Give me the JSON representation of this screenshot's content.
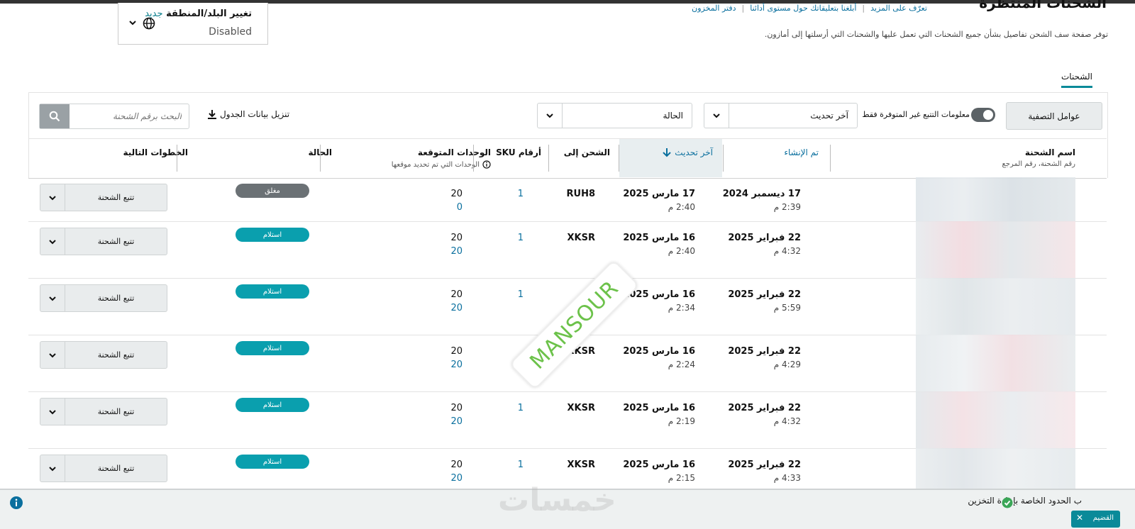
{
  "header": {
    "country_label": "تغيير البلد/المنطقة",
    "country_new": "جديد",
    "country_value": "Disabled",
    "page_title": "الشحنات المنتظرة",
    "links": [
      "تعرّف على المزيد",
      "أبلغنا بتعليقاتك حول مستوى أدائنا",
      "دفتر المخزون"
    ],
    "description": "توفر صفحة سف الشحن تفاصيل بشأن جميع الشحنات التي تعمل عليها والشحنات التي أرسلتها إلى أمازون."
  },
  "tabs": {
    "shipments": "الشحنات"
  },
  "toolbar": {
    "filters_label": "عوامل التصفية",
    "toggle_label": "معلومات التتبع غير المتوفرة فقط",
    "sort_select": "آخر تحديث",
    "status_select": "الحالة",
    "download_label": "تنزيل بيانات الجدول",
    "search_placeholder": "البحث برقم الشحنة"
  },
  "table": {
    "headers": {
      "name": "اسم الشحنة",
      "name_sub": "رقم الشحنة، رقم المرجع",
      "created": "تم الإنشاء",
      "updated": "آخر تحديث",
      "ship_to": "الشحن إلى",
      "sku": "أرقام SKU",
      "units": "الوحدات المتوقعة",
      "units_sub": "الوحدات التي تم تحديد موقعها",
      "status": "الحالة",
      "next_steps": "الخطوات التالية"
    },
    "track_label": "تتبع الشحنة",
    "rows": [
      {
        "created_date": "17 ديسمبر 2024",
        "created_time": "2:39 م",
        "updated_date": "17 مارس 2025",
        "updated_time": "2:40 م",
        "ship_to": "RUH8",
        "sku": "1",
        "units": "20",
        "located": "0",
        "status": "مغلق",
        "status_color": "#6b7175"
      },
      {
        "created_date": "22 فبراير 2025",
        "created_time": "4:32 م",
        "updated_date": "16 مارس 2025",
        "updated_time": "2:40 م",
        "ship_to": "XKSR",
        "sku": "1",
        "units": "20",
        "located": "20",
        "status": "استلام",
        "status_color": "#0a9fae"
      },
      {
        "created_date": "22 فبراير 2025",
        "created_time": "5:59 م",
        "updated_date": "16 مارس 2025",
        "updated_time": "2:34 م",
        "ship_to": "",
        "sku": "1",
        "units": "20",
        "located": "20",
        "status": "استلام",
        "status_color": "#0a9fae"
      },
      {
        "created_date": "22 فبراير 2025",
        "created_time": "4:29 م",
        "updated_date": "16 مارس 2025",
        "updated_time": "2:24 م",
        "ship_to": "XKSR",
        "sku": "",
        "units": "20",
        "located": "20",
        "status": "استلام",
        "status_color": "#0a9fae"
      },
      {
        "created_date": "22 فبراير 2025",
        "created_time": "4:32 م",
        "updated_date": "16 مارس 2025",
        "updated_time": "2:19 م",
        "ship_to": "XKSR",
        "sku": "1",
        "units": "20",
        "located": "20",
        "status": "استلام",
        "status_color": "#0a9fae"
      },
      {
        "created_date": "22 فبراير 2025",
        "created_time": "4:33 م",
        "updated_date": "16 مارس 2025",
        "updated_time": "2:15 م",
        "ship_to": "XKSR",
        "sku": "1",
        "units": "20",
        "located": "20",
        "status": "استلام",
        "status_color": "#0a9fae"
      }
    ]
  },
  "notice": {
    "text": "ب الحدود الخاصة بإعادة التخزين",
    "button": "القضيم"
  },
  "overlays": {
    "stamp": "MANSOUR",
    "site_logo": "خمسات"
  },
  "colors": {
    "accent": "#0a8a99",
    "link": "#0a6f9e",
    "closed": "#6b7175",
    "receiving": "#0a9fae"
  }
}
